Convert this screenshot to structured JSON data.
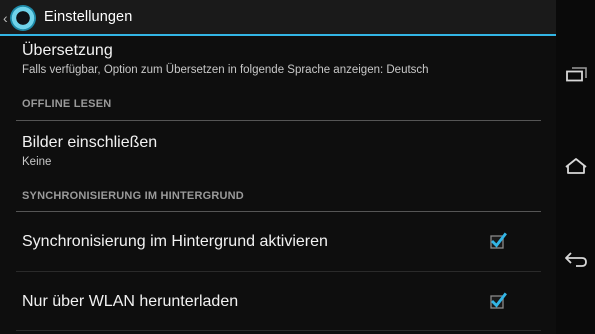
{
  "actionbar": {
    "title": "Einstellungen",
    "up_icon": "chevron-left-icon",
    "app_icon": "app-logo-icon",
    "accent": "#33b5e5"
  },
  "prefs": {
    "translation": {
      "title": "Übersetzung",
      "summary": "Falls verfügbar, Option zum Übersetzen in folgende Sprache anzeigen: Deutsch"
    },
    "offline_category": "OFFLINE LESEN",
    "images": {
      "title": "Bilder einschließen",
      "summary": "Keine"
    },
    "sync_category": "SYNCHRONISIERUNG IM HINTERGRUND",
    "background_sync": {
      "title": "Synchronisierung im Hintergrund aktivieren",
      "checked": true
    },
    "wifi_only": {
      "title": "Nur über WLAN herunterladen",
      "checked": true
    }
  },
  "navbar": {
    "recent_icon": "recent-apps-icon",
    "home_icon": "home-icon",
    "back_icon": "back-icon"
  }
}
